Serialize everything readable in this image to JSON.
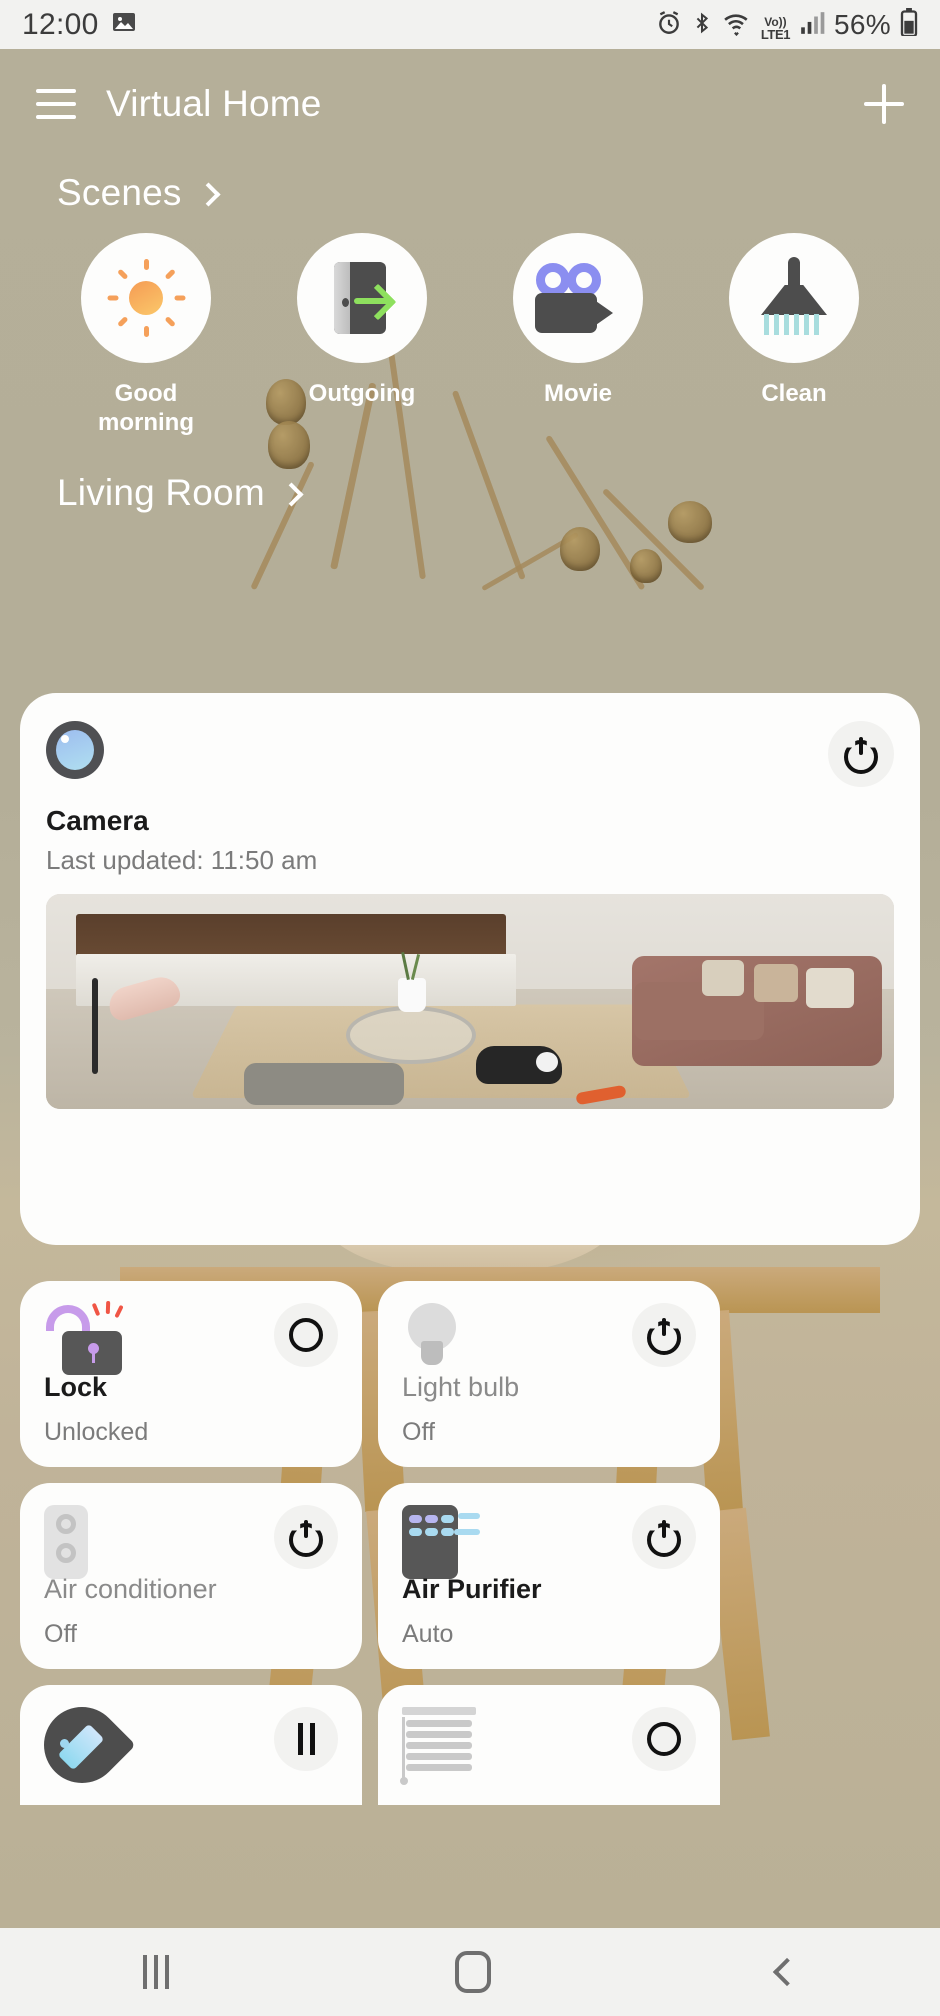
{
  "status_bar": {
    "time": "12:00",
    "gallery_icon": "image-icon",
    "icons": [
      "alarm-icon",
      "bluetooth-icon",
      "wifi-icon"
    ],
    "network_top": "Vo))",
    "network_bottom": "LTE1",
    "battery_percent": "56%"
  },
  "header": {
    "menu_icon": "hamburger-menu-icon",
    "title": "Virtual Home",
    "add_icon": "plus-icon"
  },
  "scenes_section": {
    "title": "Scenes",
    "chevron": "chevron-right-icon",
    "items": [
      {
        "label": "Good\nmorning",
        "icon": "sun-icon"
      },
      {
        "label": "Outgoing",
        "icon": "door-exit-icon"
      },
      {
        "label": "Movie",
        "icon": "movie-camera-icon"
      },
      {
        "label": "Clean",
        "icon": "broom-icon"
      }
    ]
  },
  "room_section": {
    "title": "Living Room",
    "chevron": "chevron-right-icon"
  },
  "camera_card": {
    "icon": "camera-lens-icon",
    "name": "Camera",
    "subtitle": "Last updated: 11:50 am",
    "toggle_icon": "power-icon",
    "feed_label": "living-room-camera-feed"
  },
  "devices": [
    {
      "name": "Lock",
      "state": "Unlocked",
      "icon": "unlocked-padlock-icon",
      "toggle_icon": "circle-icon",
      "active": true
    },
    {
      "name": "Light bulb",
      "state": "Off",
      "icon": "light-bulb-icon",
      "toggle_icon": "power-icon",
      "active": false
    },
    {
      "name": "Air conditioner",
      "state": "Off",
      "icon": "air-conditioner-icon",
      "toggle_icon": "power-icon",
      "active": false
    },
    {
      "name": "Air Purifier",
      "state": "Auto",
      "icon": "air-purifier-icon",
      "toggle_icon": "power-icon",
      "active": true
    },
    {
      "name": "",
      "state": "",
      "icon": "humidifier-droplet-icon",
      "toggle_icon": "pause-icon",
      "active": true
    },
    {
      "name": "",
      "state": "",
      "icon": "window-blinds-icon",
      "toggle_icon": "circle-icon",
      "active": true
    }
  ],
  "nav_bar": {
    "recents": "recents-icon",
    "home": "home-icon",
    "back": "back-icon"
  },
  "colors": {
    "background": "#b3ad97",
    "card": "#fdfdfc",
    "accent_sun": "#f5a05a",
    "accent_green": "#8ee05e",
    "accent_purple": "#8b8ef0",
    "accent_cyan": "#a8ddde",
    "text_primary": "#1b1b1b",
    "text_secondary": "#7b7b7b"
  }
}
